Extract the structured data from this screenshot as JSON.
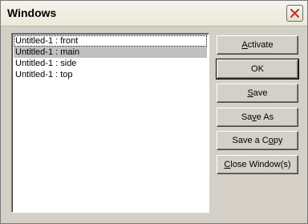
{
  "window": {
    "title": "Windows",
    "close_icon": "close-icon"
  },
  "list": {
    "items": [
      {
        "label": "Untitled-1 : front"
      },
      {
        "label": "Untitled-1 : main"
      },
      {
        "label": "Untitled-1 : side"
      },
      {
        "label": "Untitled-1 : top"
      }
    ],
    "selected_index": 1
  },
  "buttons": {
    "activate": {
      "pre": "",
      "key": "A",
      "post": "ctivate"
    },
    "ok": {
      "label": "OK"
    },
    "save": {
      "pre": "",
      "key": "S",
      "post": "ave"
    },
    "save_as": {
      "pre": "Sa",
      "key": "v",
      "post": "e As"
    },
    "save_copy": {
      "pre": "Save a C",
      "key": "o",
      "post": "py"
    },
    "close_windows": {
      "pre": "",
      "key": "C",
      "post": "lose Window(s)"
    }
  }
}
